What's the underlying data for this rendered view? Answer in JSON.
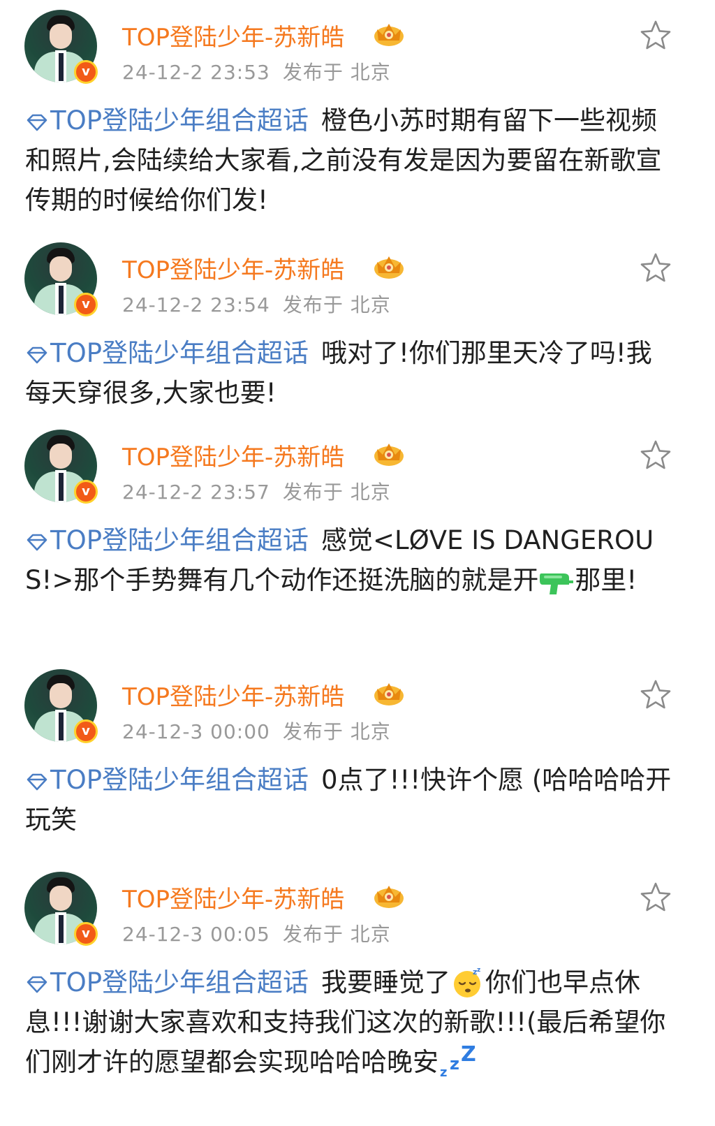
{
  "posts": [
    {
      "author": "TOP登陆少年-苏新皓",
      "time": "24-12-2 23:53",
      "location": "发布于 北京",
      "topic": "TOP登陆少年组合超话",
      "text": "橙色小苏时期有留下一些视频和照片,会陆续给大家看,之前没有发是因为要留在新歌宣传期的时候给你们发!"
    },
    {
      "author": "TOP登陆少年-苏新皓",
      "time": "24-12-2 23:54",
      "location": "发布于 北京",
      "topic": "TOP登陆少年组合超话",
      "text": "哦对了!你们那里天冷了吗!我每天穿很多,大家也要!"
    },
    {
      "author": "TOP登陆少年-苏新皓",
      "time": "24-12-2 23:57",
      "location": "发布于 北京",
      "topic": "TOP登陆少年组合超话",
      "text_a": "感觉<LØVE IS DANGEROUS!>那个手势舞有几个动作还挺洗脑的就是开",
      "text_b": "那里!"
    },
    {
      "author": "TOP登陆少年-苏新皓",
      "time": "24-12-3 00:00",
      "location": "发布于 北京",
      "topic": "TOP登陆少年组合超话",
      "text": "0点了!!!快许个愿 (哈哈哈哈开玩笑"
    },
    {
      "author": "TOP登陆少年-苏新皓",
      "time": "24-12-3 00:05",
      "location": "发布于 北京",
      "topic": "TOP登陆少年组合超话",
      "text_a": "我要睡觉了",
      "text_b": "你们也早点休息!!!谢谢大家喜欢和支持我们这次的新歌!!!(最后希望你们刚才许的愿望都会实现哈哈哈晚安"
    }
  ],
  "colors": {
    "author": "#f5791f",
    "topic": "#4a7dc4",
    "meta": "#999999",
    "verified": "#f25a17"
  },
  "icons": [
    "crown-badge-icon",
    "star-icon",
    "topic-diamond-icon",
    "verified-icon",
    "water-gun-emoji",
    "sleepy-face-emoji",
    "zzz-emoji"
  ]
}
